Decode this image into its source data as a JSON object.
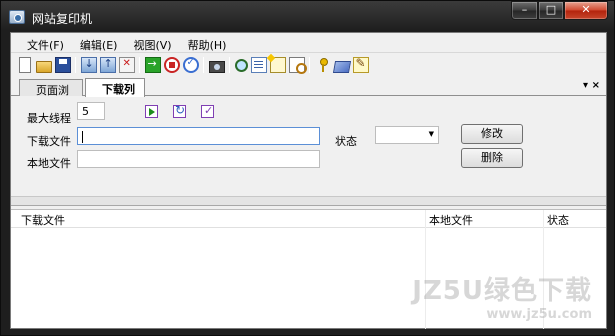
{
  "window": {
    "title": "网站复印机"
  },
  "menu": [
    "文件(F)",
    "编辑(E)",
    "视图(V)",
    "帮助(H)"
  ],
  "tabs": {
    "tab1": "页面浏览",
    "tab2": "下载列表",
    "dropdown_icon": "▾",
    "close_icon": "×"
  },
  "form": {
    "max_threads_label": "最大线程",
    "max_threads_value": "5",
    "download_file_label": "下载文件",
    "download_file_value": "",
    "local_file_label": "本地文件",
    "local_file_value": "",
    "status_label": "状态",
    "status_value": "",
    "modify_button": "修改",
    "delete_button": "删除"
  },
  "list": {
    "columns": [
      "下载文件",
      "本地文件",
      "状态"
    ]
  },
  "watermark": {
    "line1": "JZ5U绿色下载",
    "line2": "www.jz5u.com"
  }
}
